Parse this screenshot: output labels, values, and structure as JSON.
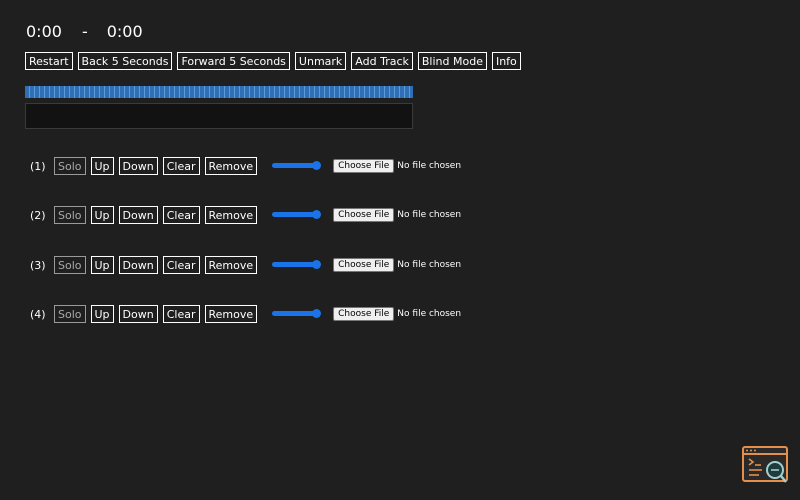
{
  "time": {
    "current": "0:00",
    "separator": "-",
    "total": "0:00"
  },
  "toolbar": {
    "restart": "Restart",
    "back": "Back 5 Seconds",
    "forward": "Forward 5 Seconds",
    "unmark": "Unmark",
    "add_track": "Add Track",
    "blind_mode": "Blind Mode",
    "info": "Info"
  },
  "tracks": [
    {
      "number": "(1)",
      "solo": "Solo",
      "up": "Up",
      "down": "Down",
      "clear": "Clear",
      "remove": "Remove",
      "volume": 1.0,
      "choose_file": "Choose File",
      "file_status": "No file chosen"
    },
    {
      "number": "(2)",
      "solo": "Solo",
      "up": "Up",
      "down": "Down",
      "clear": "Clear",
      "remove": "Remove",
      "volume": 1.0,
      "choose_file": "Choose File",
      "file_status": "No file chosen"
    },
    {
      "number": "(3)",
      "solo": "Solo",
      "up": "Up",
      "down": "Down",
      "clear": "Clear",
      "remove": "Remove",
      "volume": 1.0,
      "choose_file": "Choose File",
      "file_status": "No file chosen"
    },
    {
      "number": "(4)",
      "solo": "Solo",
      "up": "Up",
      "down": "Down",
      "clear": "Clear",
      "remove": "Remove",
      "volume": 1.0,
      "choose_file": "Choose File",
      "file_status": "No file chosen"
    }
  ],
  "colors": {
    "background": "#1f1f1f",
    "accent": "#1a73e8",
    "progress": "#2f6fb6",
    "logo": "#e58f4a"
  },
  "icons": {
    "logo": "terminal-search-logo-icon"
  }
}
